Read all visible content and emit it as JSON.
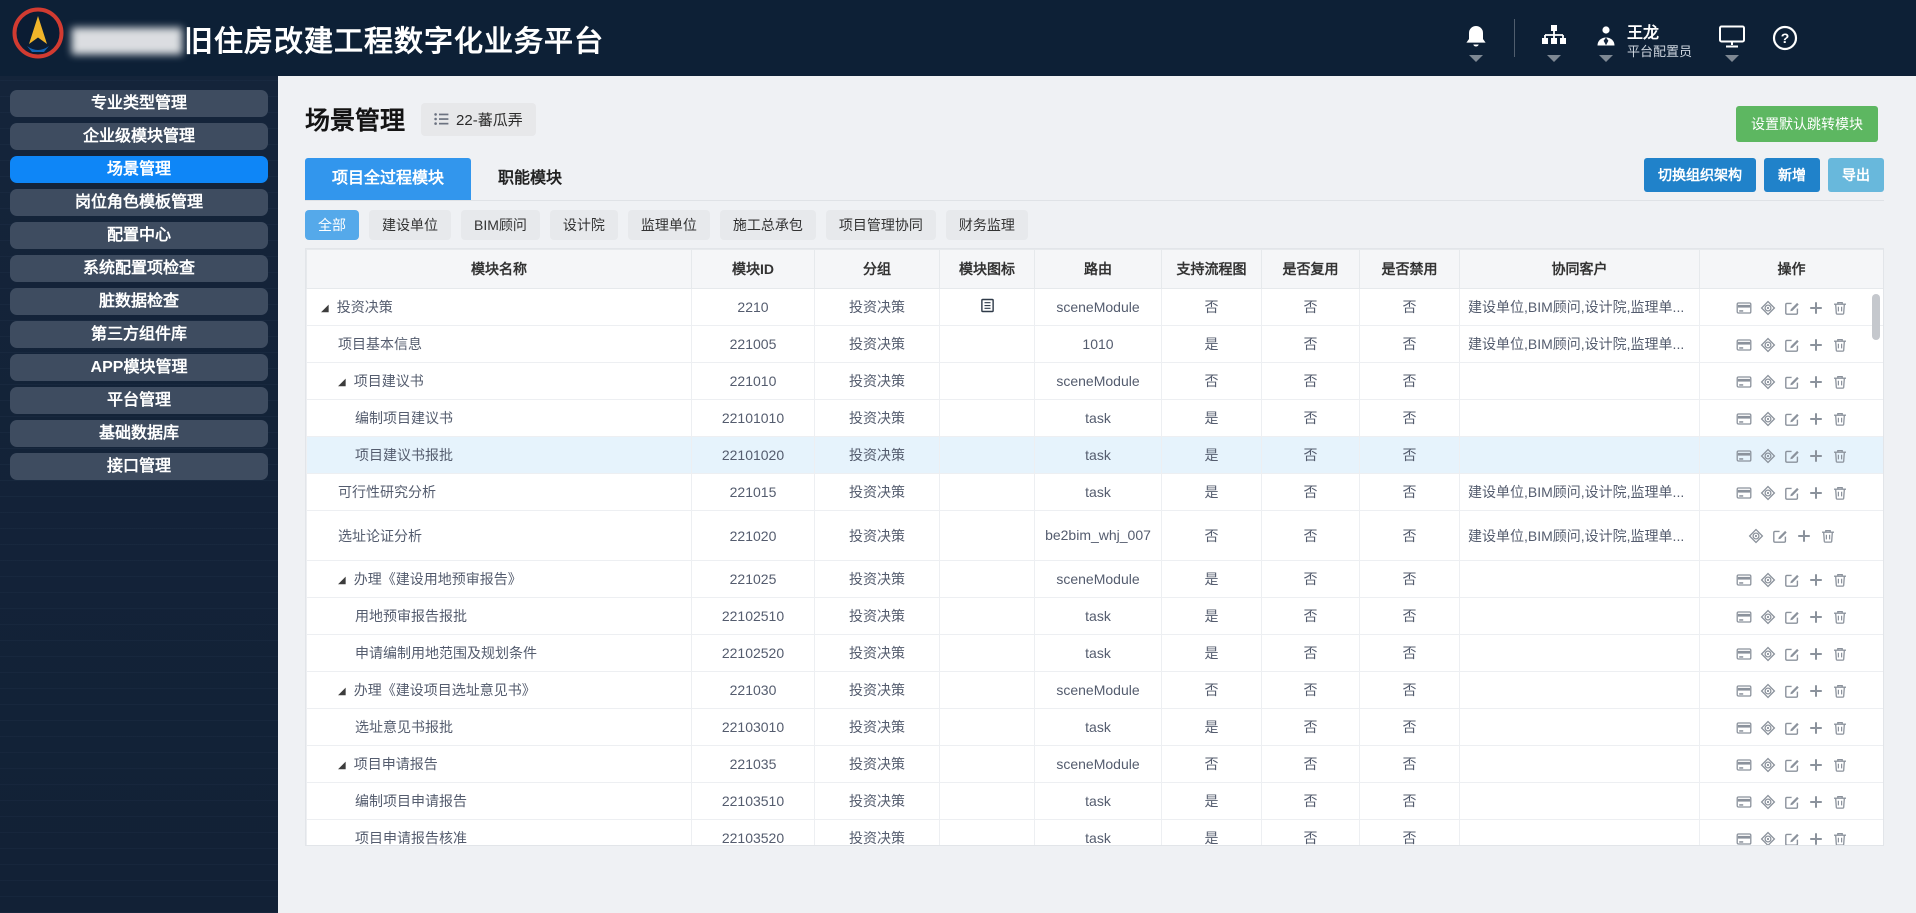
{
  "header": {
    "title_masked": "▇▇▇▇▇▇",
    "title": "旧住房改建工程数字化业务平台",
    "user": {
      "name": "王龙",
      "role": "平台配置员"
    }
  },
  "sidebar": {
    "items": [
      {
        "label": "专业类型管理",
        "active": false
      },
      {
        "label": "企业级模块管理",
        "active": false
      },
      {
        "label": "场景管理",
        "active": true
      },
      {
        "label": "岗位角色模板管理",
        "active": false
      },
      {
        "label": "配置中心",
        "active": false
      },
      {
        "label": "系统配置项检查",
        "active": false
      },
      {
        "label": "脏数据检查",
        "active": false
      },
      {
        "label": "第三方组件库",
        "active": false
      },
      {
        "label": "APP模块管理",
        "active": false
      },
      {
        "label": "平台管理",
        "active": false
      },
      {
        "label": "基础数据库",
        "active": false
      },
      {
        "label": "接口管理",
        "active": false
      }
    ]
  },
  "page": {
    "title": "场景管理",
    "badge": "22-蕃瓜弄",
    "set_default_label": "设置默认跳转模块",
    "tabs": [
      {
        "label": "项目全过程模块",
        "active": true
      },
      {
        "label": "职能模块",
        "active": false
      }
    ],
    "toolbar_buttons": [
      {
        "label": "切换组织架构",
        "variant": "primary"
      },
      {
        "label": "新增",
        "variant": "primary"
      },
      {
        "label": "导出",
        "variant": "info"
      }
    ],
    "filters": [
      {
        "label": "全部",
        "active": true
      },
      {
        "label": "建设单位",
        "active": false
      },
      {
        "label": "BIM顾问",
        "active": false
      },
      {
        "label": "设计院",
        "active": false
      },
      {
        "label": "监理单位",
        "active": false
      },
      {
        "label": "施工总承包",
        "active": false
      },
      {
        "label": "项目管理协同",
        "active": false
      },
      {
        "label": "财务监理",
        "active": false
      }
    ]
  },
  "table": {
    "columns": [
      "模块名称",
      "模块ID",
      "分组",
      "模块图标",
      "路由",
      "支持流程图",
      "是否复用",
      "是否禁用",
      "协同客户",
      "操作"
    ],
    "rows": [
      {
        "level": 0,
        "expand": true,
        "name": "投资决策",
        "id": "2210",
        "group": "投资决策",
        "module_icon": true,
        "route": "sceneModule",
        "flow": "否",
        "reuse": "否",
        "disabled": "否",
        "clients": "建设单位,BIM顾问,设计院,监理单...",
        "ops": [
          "card",
          "aim",
          "edit",
          "add",
          "delete"
        ],
        "highlight": false,
        "tall": false
      },
      {
        "level": 1,
        "expand": false,
        "name": "项目基本信息",
        "id": "221005",
        "group": "投资决策",
        "module_icon": false,
        "route": "1010",
        "flow": "是",
        "reuse": "否",
        "disabled": "否",
        "clients": "建设单位,BIM顾问,设计院,监理单...",
        "ops": [
          "card",
          "aim",
          "edit",
          "add",
          "delete"
        ],
        "highlight": false,
        "tall": false
      },
      {
        "level": 1,
        "expand": true,
        "name": "项目建议书",
        "id": "221010",
        "group": "投资决策",
        "module_icon": false,
        "route": "sceneModule",
        "flow": "否",
        "reuse": "否",
        "disabled": "否",
        "clients": "",
        "ops": [
          "card",
          "aim",
          "edit",
          "add",
          "delete"
        ],
        "highlight": false,
        "tall": false
      },
      {
        "level": 2,
        "expand": false,
        "name": "编制项目建议书",
        "id": "22101010",
        "group": "投资决策",
        "module_icon": false,
        "route": "task",
        "flow": "是",
        "reuse": "否",
        "disabled": "否",
        "clients": "",
        "ops": [
          "card",
          "aim",
          "edit",
          "add",
          "delete"
        ],
        "highlight": false,
        "tall": false
      },
      {
        "level": 2,
        "expand": false,
        "name": "项目建议书报批",
        "id": "22101020",
        "group": "投资决策",
        "module_icon": false,
        "route": "task",
        "flow": "是",
        "reuse": "否",
        "disabled": "否",
        "clients": "",
        "ops": [
          "card",
          "aim",
          "edit",
          "add",
          "delete"
        ],
        "highlight": true,
        "tall": false
      },
      {
        "level": 1,
        "expand": false,
        "name": "可行性研究分析",
        "id": "221015",
        "group": "投资决策",
        "module_icon": false,
        "route": "task",
        "flow": "是",
        "reuse": "否",
        "disabled": "否",
        "clients": "建设单位,BIM顾问,设计院,监理单...",
        "ops": [
          "card",
          "aim",
          "edit",
          "add",
          "delete"
        ],
        "highlight": false,
        "tall": false
      },
      {
        "level": 1,
        "expand": false,
        "name": "选址论证分析",
        "id": "221020",
        "group": "投资决策",
        "module_icon": false,
        "route": "be2bim_whj_007",
        "flow": "否",
        "reuse": "否",
        "disabled": "否",
        "clients": "建设单位,BIM顾问,设计院,监理单...",
        "ops": [
          "aim",
          "edit",
          "add",
          "delete"
        ],
        "highlight": false,
        "tall": true
      },
      {
        "level": 1,
        "expand": true,
        "name": "办理《建设用地预审报告》",
        "id": "221025",
        "group": "投资决策",
        "module_icon": false,
        "route": "sceneModule",
        "flow": "是",
        "reuse": "否",
        "disabled": "否",
        "clients": "",
        "ops": [
          "card",
          "aim",
          "edit",
          "add",
          "delete"
        ],
        "highlight": false,
        "tall": false
      },
      {
        "level": 2,
        "expand": false,
        "name": "用地预审报告报批",
        "id": "22102510",
        "group": "投资决策",
        "module_icon": false,
        "route": "task",
        "flow": "是",
        "reuse": "否",
        "disabled": "否",
        "clients": "",
        "ops": [
          "card",
          "aim",
          "edit",
          "add",
          "delete"
        ],
        "highlight": false,
        "tall": false
      },
      {
        "level": 2,
        "expand": false,
        "name": "申请编制用地范围及规划条件",
        "id": "22102520",
        "group": "投资决策",
        "module_icon": false,
        "route": "task",
        "flow": "是",
        "reuse": "否",
        "disabled": "否",
        "clients": "",
        "ops": [
          "card",
          "aim",
          "edit",
          "add",
          "delete"
        ],
        "highlight": false,
        "tall": false
      },
      {
        "level": 1,
        "expand": true,
        "name": "办理《建设项目选址意见书》",
        "id": "221030",
        "group": "投资决策",
        "module_icon": false,
        "route": "sceneModule",
        "flow": "否",
        "reuse": "否",
        "disabled": "否",
        "clients": "",
        "ops": [
          "card",
          "aim",
          "edit",
          "add",
          "delete"
        ],
        "highlight": false,
        "tall": false
      },
      {
        "level": 2,
        "expand": false,
        "name": "选址意见书报批",
        "id": "22103010",
        "group": "投资决策",
        "module_icon": false,
        "route": "task",
        "flow": "是",
        "reuse": "否",
        "disabled": "否",
        "clients": "",
        "ops": [
          "card",
          "aim",
          "edit",
          "add",
          "delete"
        ],
        "highlight": false,
        "tall": false
      },
      {
        "level": 1,
        "expand": true,
        "name": "项目申请报告",
        "id": "221035",
        "group": "投资决策",
        "module_icon": false,
        "route": "sceneModule",
        "flow": "否",
        "reuse": "否",
        "disabled": "否",
        "clients": "",
        "ops": [
          "card",
          "aim",
          "edit",
          "add",
          "delete"
        ],
        "highlight": false,
        "tall": false
      },
      {
        "level": 2,
        "expand": false,
        "name": "编制项目申请报告",
        "id": "22103510",
        "group": "投资决策",
        "module_icon": false,
        "route": "task",
        "flow": "是",
        "reuse": "否",
        "disabled": "否",
        "clients": "",
        "ops": [
          "card",
          "aim",
          "edit",
          "add",
          "delete"
        ],
        "highlight": false,
        "tall": false
      },
      {
        "level": 2,
        "expand": false,
        "name": "项目申请报告核准",
        "id": "22103520",
        "group": "投资决策",
        "module_icon": false,
        "route": "task",
        "flow": "是",
        "reuse": "否",
        "disabled": "否",
        "clients": "",
        "ops": [
          "card",
          "aim",
          "edit",
          "add",
          "delete"
        ],
        "highlight": false,
        "tall": false
      }
    ]
  },
  "colors": {
    "sidebar_active": "#0e86f7",
    "tab_active": "#3296ed",
    "chip_active": "#55a9ea",
    "button_primary": "#2082ca",
    "button_info": "#68b8dc",
    "button_green": "#5db761",
    "row_highlight": "#e6f3fc"
  }
}
